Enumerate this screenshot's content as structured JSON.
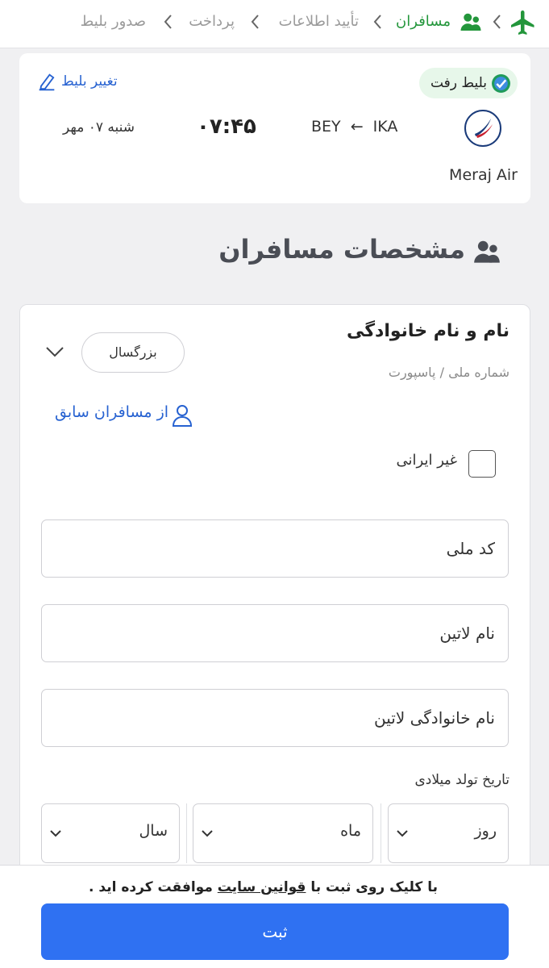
{
  "breadcrumb": {
    "passengers": "مسافران",
    "confirm": "تأیید اطلاعات",
    "payment": "پرداخت",
    "issue": "صدور بلیط"
  },
  "ticket": {
    "badge": "بلیط رفت",
    "change_link": "تغییر بلیط",
    "origin": "IKA",
    "destination": "BEY",
    "time": "۰۷:۴۵",
    "date": "شنبه ۰۷ مهر",
    "airline": "Meraj Air"
  },
  "section_title": "مشخصات مسافران",
  "passenger": {
    "name_title": "نام و نام خانوادگی",
    "subtitle": "شماره ملی / پاسپورت",
    "type": "بزرگسال",
    "previous_link": "از مسافران سابق",
    "non_iranian": "غیر ایرانی",
    "national_code": "کد ملی",
    "latin_name": "نام لاتین",
    "latin_family": "نام خانوادگی لاتین",
    "dob_label": "تاریخ تولد میلادی",
    "dob": {
      "day": "روز",
      "month": "ماه",
      "year": "سال"
    }
  },
  "footer": {
    "terms_pre": "با کلیک روی ثبت با",
    "terms_link": "قوانین سایت",
    "terms_post": "موافقت کرده اید .",
    "submit": "ثبت"
  },
  "colors": {
    "accent_green": "#23963b",
    "link_blue": "#2762d1",
    "primary_button": "#2f71f2"
  },
  "icons": [
    "plane-icon",
    "passengers-icon",
    "chevron-left-icon",
    "check-badge-icon",
    "pencil-icon",
    "user-icon",
    "chevron-down-icon"
  ]
}
